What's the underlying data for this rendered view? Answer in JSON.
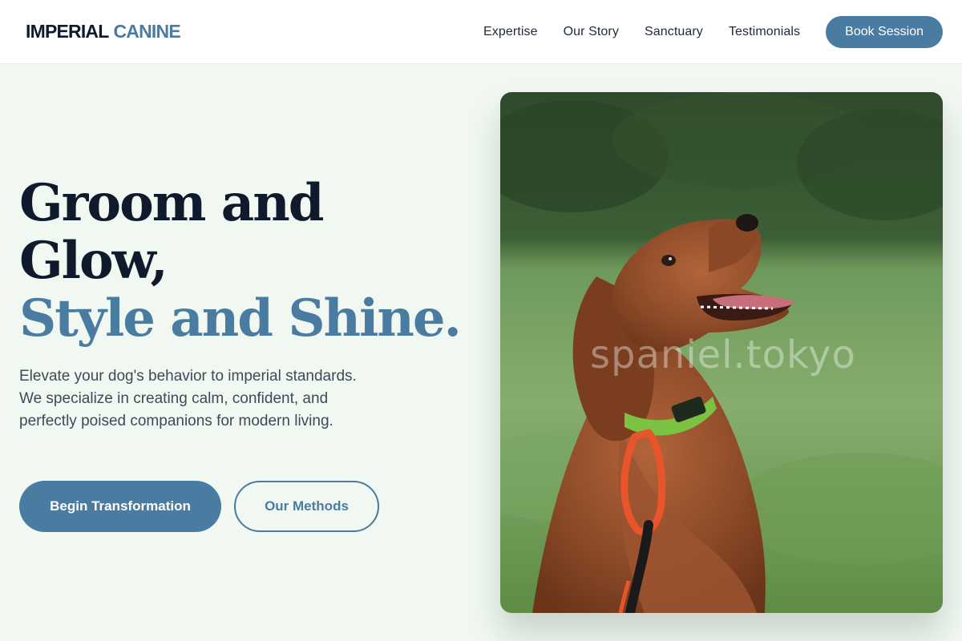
{
  "header": {
    "brand_primary": "IMPERIAL",
    "brand_accent": "CANINE",
    "nav": [
      "Expertise",
      "Our Story",
      "Sanctuary",
      "Testimonials"
    ],
    "cta_label": "Book Session"
  },
  "hero": {
    "title_line1": "Groom and",
    "title_line2": "Glow,",
    "title_line3": "Style and Shine.",
    "description": "Elevate your dog's behavior to imperial standards. We specialize in creating calm, confident, and perfectly poised companions for modern living.",
    "primary_button": "Begin Transformation",
    "secondary_button": "Our Methods"
  },
  "photo": {
    "subject": "dog-photo",
    "watermark": "spaniel.tokyo"
  },
  "colors": {
    "accent": "#4a7ba0",
    "dark_text": "#0f1b2d",
    "background": "#f0f8f1"
  }
}
